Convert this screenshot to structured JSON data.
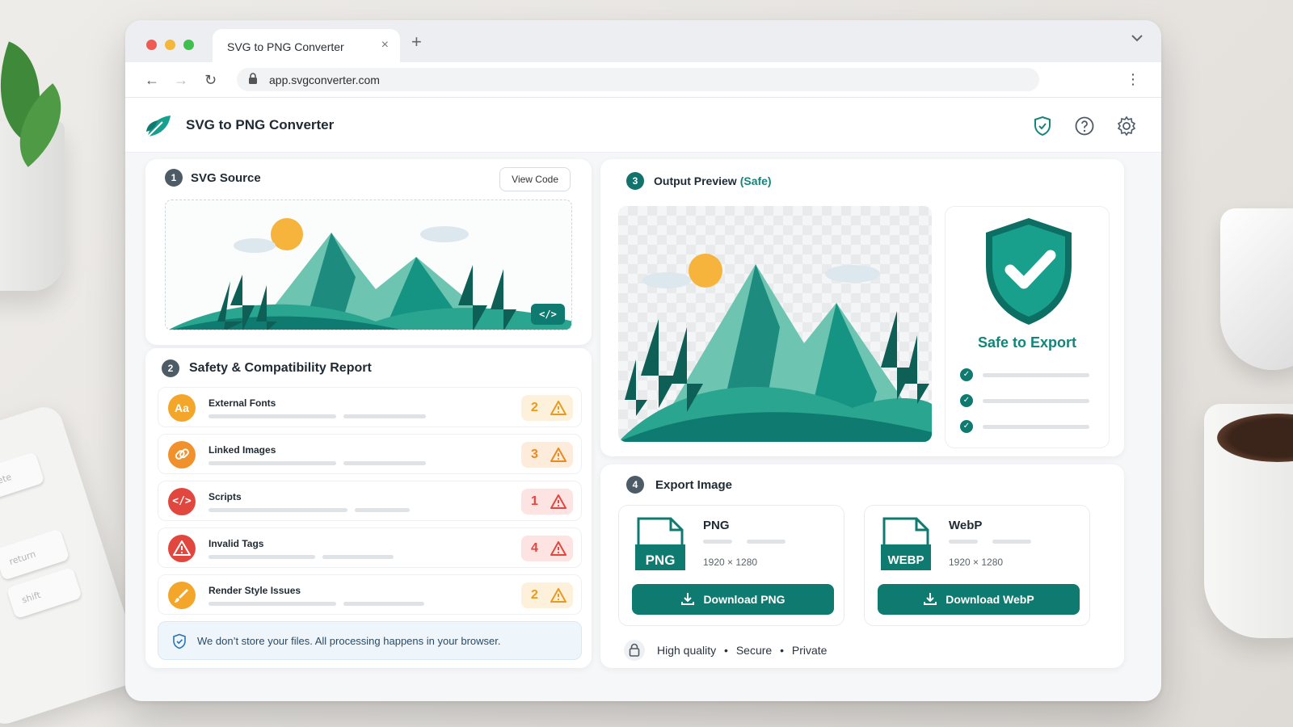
{
  "browser": {
    "tab_title": "SVG to PNG Converter",
    "tab_close": "×",
    "new_tab": "+",
    "url": "app.svgconverter.com",
    "nav_back": "←",
    "nav_forward": "→",
    "nav_reload": "↻",
    "menu": "⋮",
    "tab_list": "⌄"
  },
  "app": {
    "title": "SVG to PNG Converter",
    "header_icons": [
      "shield-check-icon",
      "help-icon",
      "gear-icon"
    ]
  },
  "svg_source": {
    "step": "1",
    "title": "SVG Source",
    "view_code_label": "View Code",
    "code_chip": "</>"
  },
  "report": {
    "step": "2",
    "title": "Safety & Compatibility Report",
    "items": [
      {
        "label": "External Fonts",
        "count": "2",
        "icon": "Aa",
        "color": "#f4a62a",
        "severity": "warning"
      },
      {
        "label": "Linked Images",
        "count": "3",
        "icon": "link-icon",
        "color": "#f0912b",
        "severity": "warning"
      },
      {
        "label": "Scripts",
        "count": "1",
        "icon": "</>",
        "color": "#e2473f",
        "severity": "danger"
      },
      {
        "label": "Invalid Tags",
        "count": "4",
        "icon": "warning-icon",
        "color": "#e2473f",
        "severity": "danger"
      },
      {
        "label": "Render Style Issues",
        "count": "2",
        "icon": "brush-icon",
        "color": "#f4a62a",
        "severity": "warning"
      }
    ],
    "notice": "We don’t store your files. All processing happens in your browser."
  },
  "preview": {
    "step": "3",
    "title": "Output Preview",
    "status": "(Safe)",
    "safe_label": "Safe to Export"
  },
  "export": {
    "step": "4",
    "title": "Export Image",
    "formats": [
      {
        "name": "PNG",
        "badge": "PNG",
        "dimensions": "1920 × 1280",
        "button": "Download PNG"
      },
      {
        "name": "WebP",
        "badge": "WEBP",
        "dimensions": "1920 × 1280",
        "button": "Download WebP"
      }
    ],
    "features": [
      "High quality",
      "Secure",
      "Private"
    ],
    "separator": "•"
  },
  "colors": {
    "accent": "#0f7a70",
    "safe_text": "#13857a",
    "warning": "#f4a62a",
    "danger": "#e2473f"
  },
  "desk": {
    "keyboard_keys": [
      "delete",
      "return",
      "shift"
    ]
  }
}
